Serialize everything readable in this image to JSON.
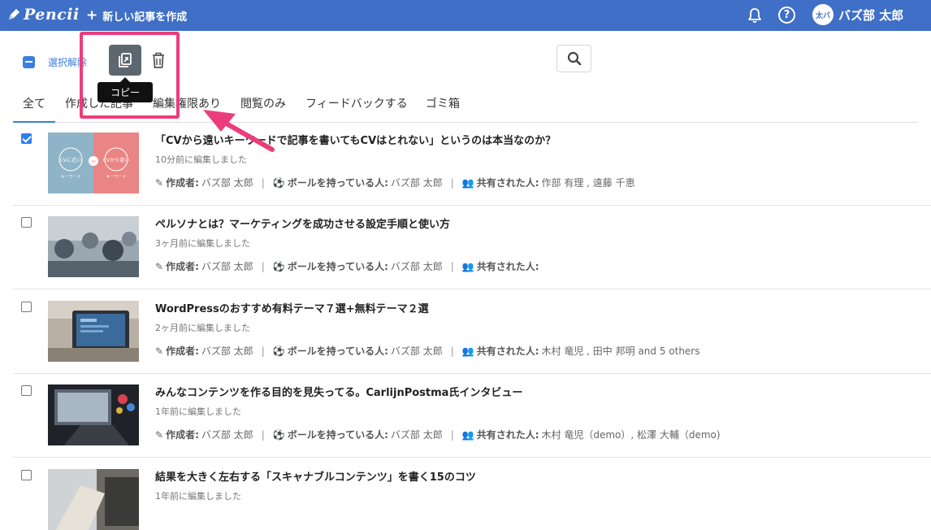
{
  "app": {
    "logo": "Pencii",
    "new_article": "新しい記事を作成"
  },
  "user": {
    "avatar_text": "太バ",
    "name": "バズ部 太郎"
  },
  "toolbar": {
    "deselect": "選択解除",
    "copy_tooltip": "コピー"
  },
  "tabs": [
    {
      "label": "全て",
      "active": true
    },
    {
      "label": "作成した記事"
    },
    {
      "label": "編集権限あり"
    },
    {
      "label": "閲覧のみ"
    },
    {
      "label": "フィードバックする"
    },
    {
      "label": "ゴミ箱"
    }
  ],
  "meta_labels": {
    "author": "作成者:",
    "ball": "ボールを持っている人:",
    "shared": "共有された人:"
  },
  "articles": [
    {
      "checked": true,
      "title": "「CVから遠いキーワードで記事を書いてもCVはとれない」というのは本当なのか？",
      "edited": "10分前に編集しました",
      "author": "バズ部 太郎",
      "ball": "バズ部 太郎",
      "shared": "作部 有理 , 遠藤 千恵",
      "thumb": {
        "left_label": "CVに近い",
        "vs": "vs",
        "right_label": "CVから遠い",
        "caption": "キーワード"
      }
    },
    {
      "checked": false,
      "title": "ペルソナとは？マーケティングを成功させる設定手順と使い方",
      "edited": "3ヶ月前に編集しました",
      "author": "バズ部 太郎",
      "ball": "バズ部 太郎",
      "shared": ""
    },
    {
      "checked": false,
      "title": "WordPressのおすすめ有料テーマ７選+無料テーマ２選",
      "edited": "2ヶ月前に編集しました",
      "author": "バズ部 太郎",
      "ball": "バズ部 太郎",
      "shared": "木村 竜児 , 田中 邦明 and 5 others"
    },
    {
      "checked": false,
      "title": "みんなコンテンツを作る目的を見失ってる。CarlijnPostma氏インタビュー",
      "edited": "1年前に編集しました",
      "author": "バズ部 太郎",
      "ball": "バズ部 太郎",
      "shared": "木村 竜児（demo）, 松澤 大輔（demo)"
    },
    {
      "checked": false,
      "title": "結果を大きく左右する「スキャナブルコンテンツ」を書く15のコツ",
      "edited": "1年前に編集しました",
      "author": "",
      "ball": "",
      "shared": ""
    }
  ],
  "colors": {
    "header": "#3f6fc6",
    "accent": "#3b7ee0",
    "highlight": "#ec3d7b"
  },
  "icons": [
    "pencil-logo-icon",
    "plus-icon",
    "bell-icon",
    "help-icon",
    "copy-icon",
    "trash-icon",
    "search-icon",
    "edit-icon",
    "soccer-ball-icon",
    "users-icon"
  ]
}
